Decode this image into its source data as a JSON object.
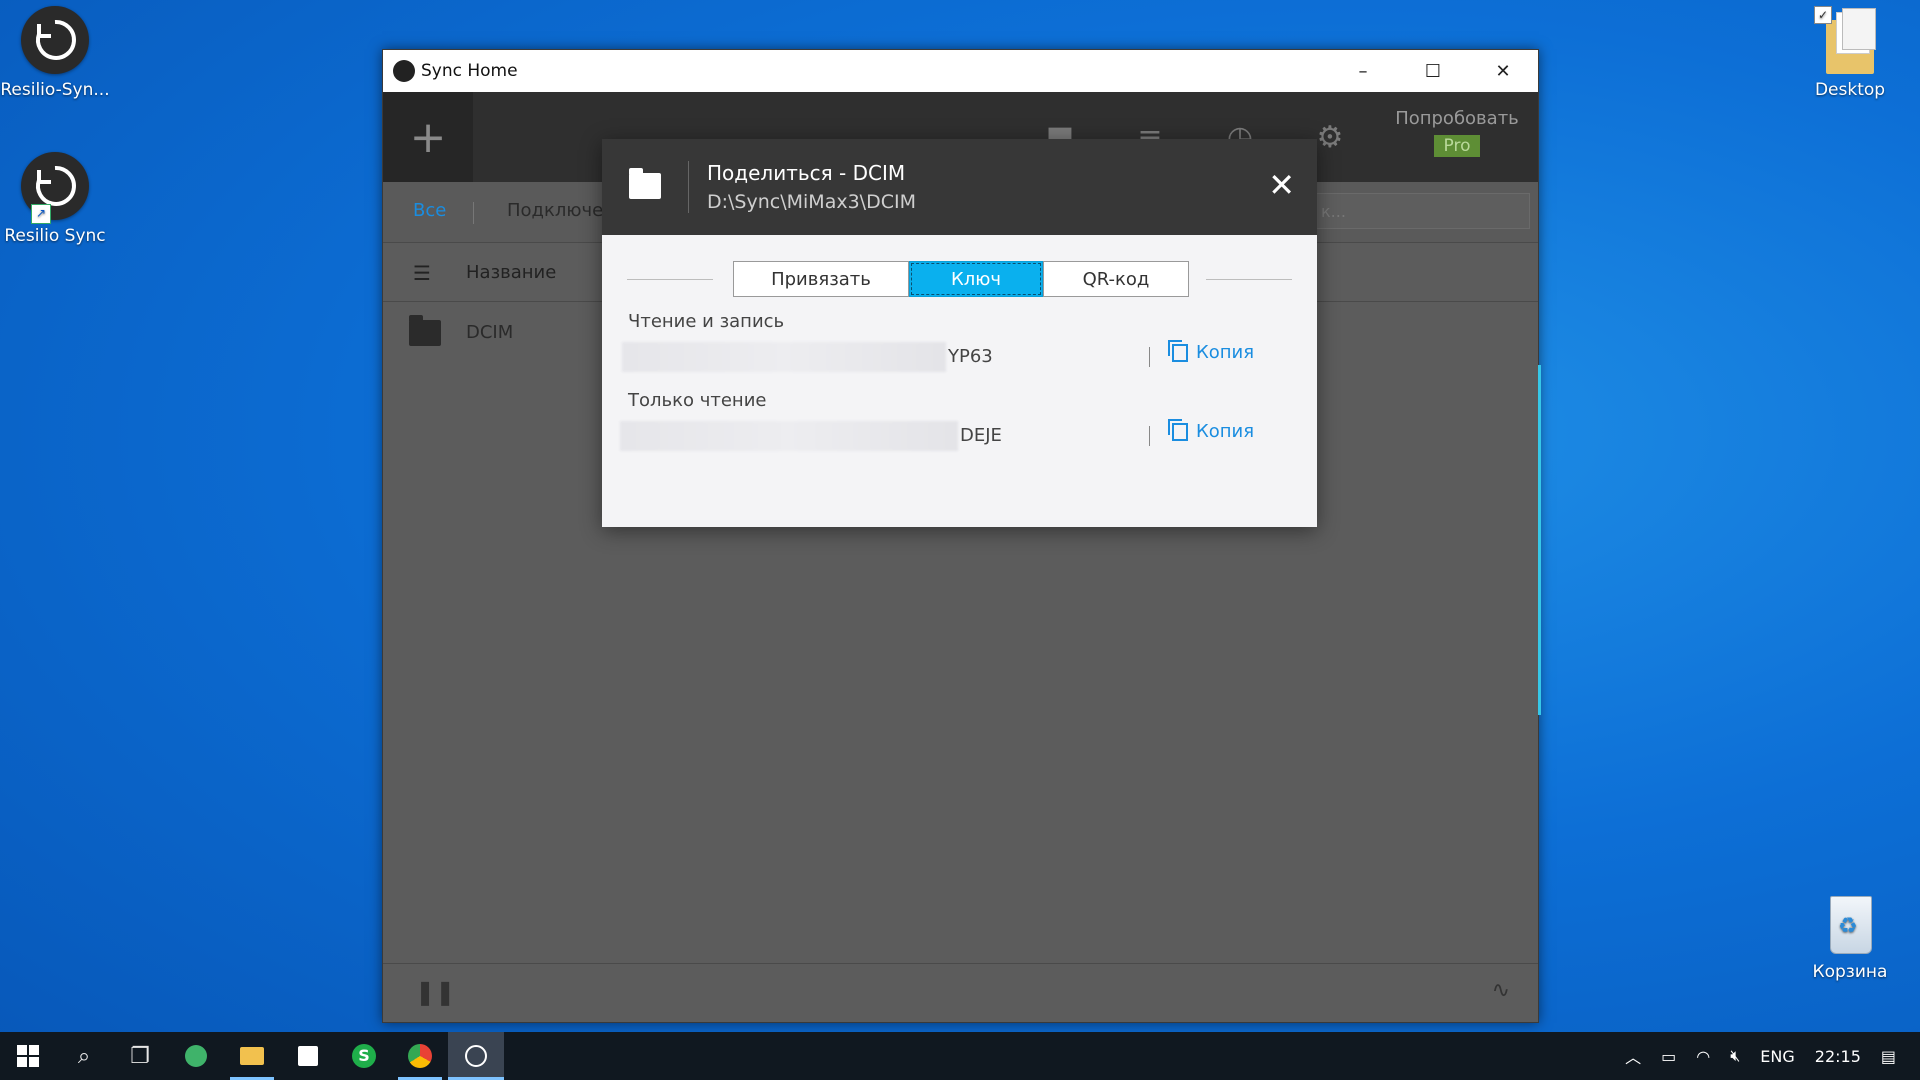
{
  "desktop": {
    "icons": [
      {
        "label": "Resilio-Syn..."
      },
      {
        "label": "Resilio Sync"
      },
      {
        "label": "Desktop"
      },
      {
        "label": "Корзина"
      }
    ]
  },
  "window": {
    "title": "Sync Home",
    "controls": {
      "minimize": "–",
      "maximize": "☐",
      "close": "✕"
    },
    "toolbar": {
      "add": "+",
      "try_label": "Попробовать",
      "pro_badge": "Pro"
    },
    "filter": {
      "all": "Все",
      "connected": "Подключе",
      "search_placeholder": "к..."
    },
    "list": {
      "column_name": "Название",
      "rows": [
        {
          "name": "DCIM"
        }
      ]
    }
  },
  "dialog": {
    "title": "Поделиться - DCIM",
    "path": "D:\\Sync\\MiMax3\\DCIM",
    "close": "✕",
    "tabs": [
      {
        "label": "Привязать",
        "active": false
      },
      {
        "label": "Ключ",
        "active": true
      },
      {
        "label": "QR-код",
        "active": false
      }
    ],
    "read_write": {
      "label": "Чтение и запись",
      "key_tail": "YP63",
      "copy": "Копия"
    },
    "read_only": {
      "label": "Только чтение",
      "key_tail": "DEJE",
      "copy": "Копия"
    }
  },
  "taskbar": {
    "tray": {
      "language": "ENG",
      "time": "22:15"
    }
  }
}
